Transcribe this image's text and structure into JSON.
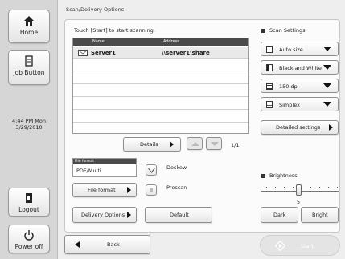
{
  "sidebar": {
    "home_label": "Home",
    "job_button_label": "Job Button",
    "clock_time": "4:44 PM  Mon",
    "clock_date": "3/29/2010",
    "logout_label": "Logout",
    "power_off_label": "Power off"
  },
  "header": {
    "title": "Scan/Delivery Options"
  },
  "destinations": {
    "instruction": "Touch [Start] to start scanning.",
    "col_name": "Name",
    "col_address": "Address",
    "rows": [
      {
        "name": "Server1",
        "address": "\\\\server1\\share"
      }
    ],
    "details_label": "Details",
    "page_indicator": "1/1"
  },
  "file_format": {
    "caption": "File format",
    "value": "PDF/Multi",
    "button_label": "File format"
  },
  "options": {
    "deskew_label": "Deskew",
    "prescan_label": "Prescan"
  },
  "buttons": {
    "delivery_options_label": "Delivery Options",
    "default_label": "Default",
    "back_label": "Back",
    "start_label": "Start"
  },
  "scan_settings": {
    "heading": "Scan Settings",
    "size": "Auto size",
    "color": "Black and White",
    "resolution": "150 dpi",
    "sides": "Simplex",
    "detailed_label": "Detailed settings"
  },
  "brightness": {
    "heading": "Brightness",
    "value": "5",
    "level_fraction": 0.5,
    "dark_label": "Dark",
    "bright_label": "Bright"
  },
  "colors": {
    "dark_header": "#4a4a4a",
    "panel": "#eeeeee",
    "start_disabled": "#e2e2e2"
  }
}
